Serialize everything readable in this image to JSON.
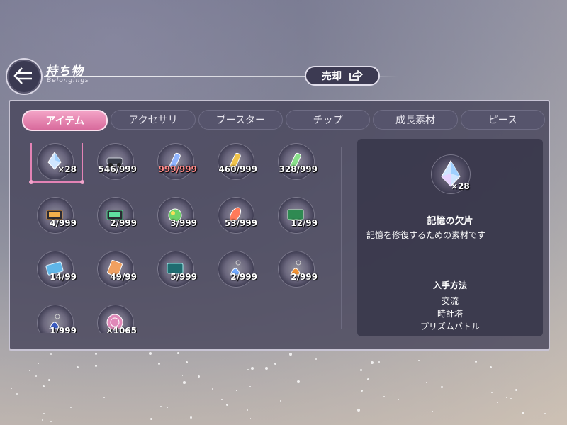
{
  "header": {
    "title": "持ち物",
    "subtitle": "Belongings",
    "sell_label": "売却"
  },
  "tabs": [
    {
      "label": "アイテム",
      "active": true
    },
    {
      "label": "アクセサリ",
      "active": false
    },
    {
      "label": "ブースター",
      "active": false
    },
    {
      "label": "チップ",
      "active": false
    },
    {
      "label": "成長素材",
      "active": false
    },
    {
      "label": "ピース",
      "active": false
    }
  ],
  "items": [
    {
      "count": "×28",
      "icon": "prism-crystal-icon",
      "selected": true
    },
    {
      "count": "546/999",
      "icon": "car-icon"
    },
    {
      "count": "999/999",
      "icon": "blue-potion-icon",
      "maxed": true
    },
    {
      "count": "460/999",
      "icon": "gold-potion-icon"
    },
    {
      "count": "328/999",
      "icon": "green-potion-icon"
    },
    {
      "count": "4/999",
      "icon": "orange-case-icon"
    },
    {
      "count": "2/999",
      "icon": "green-case-icon"
    },
    {
      "count": "3/999",
      "icon": "rainbow-orb-icon"
    },
    {
      "count": "53/999",
      "icon": "red-gem-icon"
    },
    {
      "count": "12/99",
      "icon": "green-ticket-icon"
    },
    {
      "count": "14/99",
      "icon": "blue-ticket-icon"
    },
    {
      "count": "49/99",
      "icon": "orange-card-icon"
    },
    {
      "count": "5/999",
      "icon": "teal-card-icon"
    },
    {
      "count": "2/999",
      "icon": "blue-bell-charm-icon"
    },
    {
      "count": "2/999",
      "icon": "orange-bell-charm-icon"
    },
    {
      "count": "1/999",
      "icon": "navy-bell-charm-icon"
    },
    {
      "count": "×1065",
      "icon": "pink-coin-icon"
    }
  ],
  "detail": {
    "count": "×28",
    "name": "記憶の欠片",
    "description": "記憶を修復するための素材です",
    "acquisition_title": "入手方法",
    "acquisition": [
      "交流",
      "時計塔",
      "プリズムバトル"
    ]
  },
  "colors": {
    "accent_pink": "#d86a9c",
    "panel": "#48465c",
    "maxed_count": "#ff8a8a"
  }
}
